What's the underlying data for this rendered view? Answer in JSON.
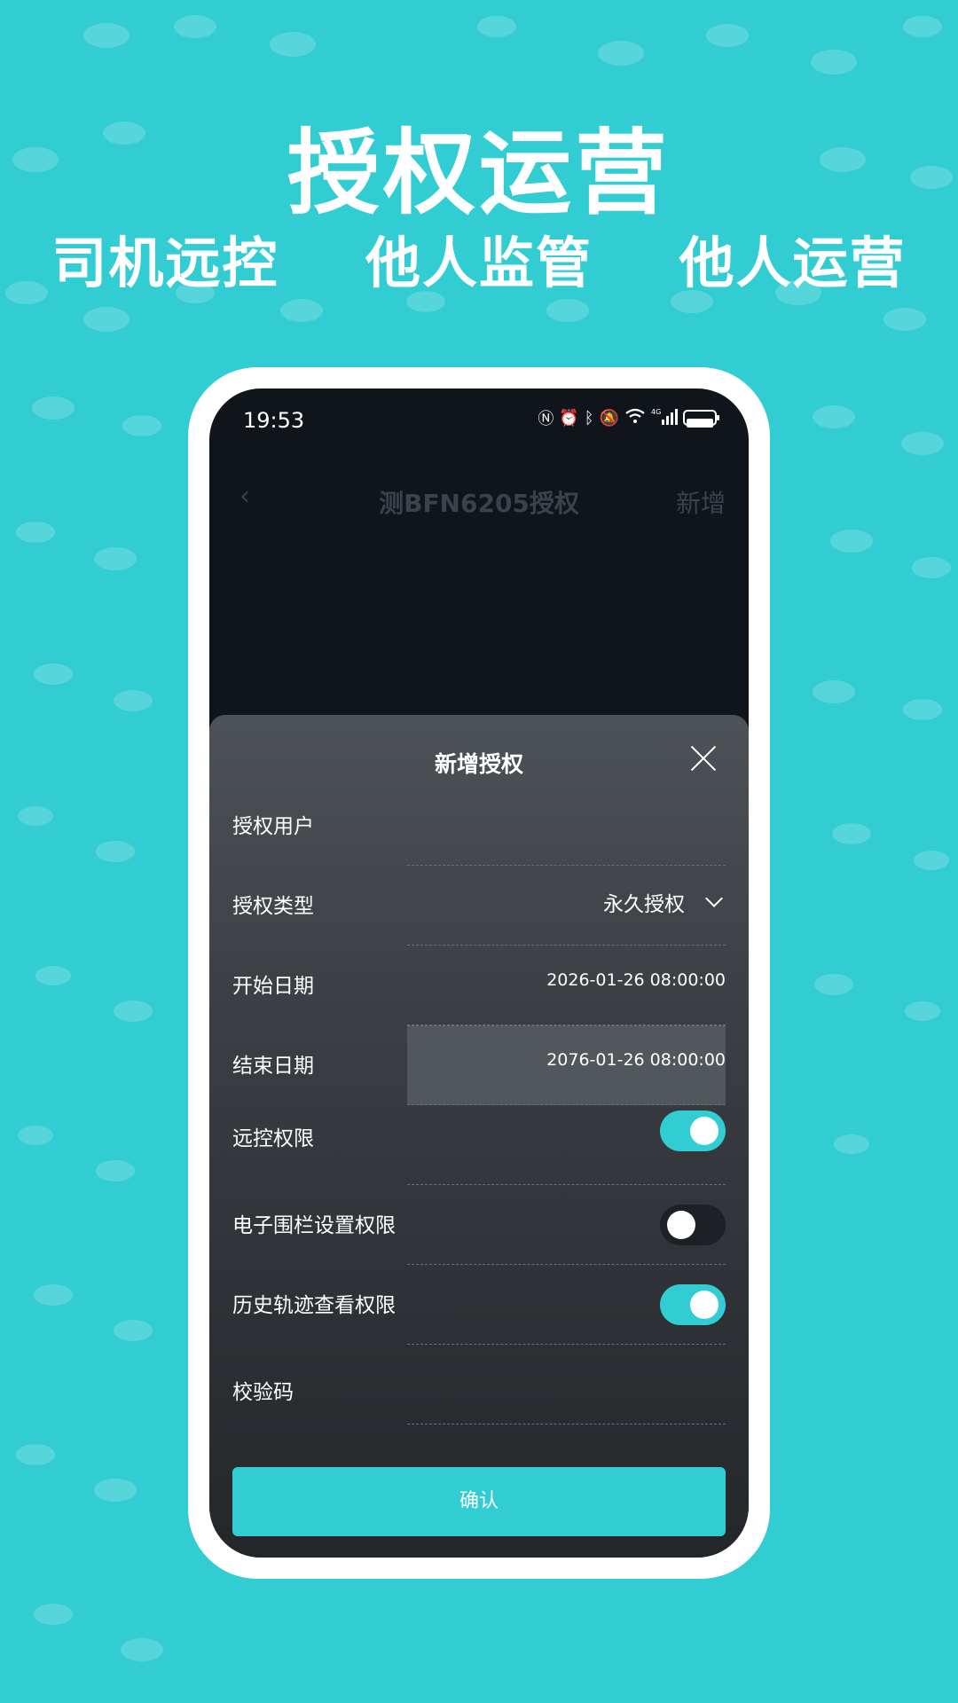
{
  "promo": {
    "headline": "授权运营",
    "sub_items": [
      "司机远控",
      "他人监管",
      "他人运营"
    ]
  },
  "status_bar": {
    "time": "19:53",
    "icons": [
      "nfc-icon",
      "alarm-icon",
      "bluetooth-icon",
      "mute-icon",
      "wifi-icon",
      "4g-signal-icon",
      "battery-icon"
    ],
    "network_label": "4G"
  },
  "nav": {
    "back_glyph": "‹",
    "title": "测BFN6205授权",
    "action_label": "新增"
  },
  "sheet": {
    "title": "新增授权",
    "fields": {
      "user": {
        "label": "授权用户",
        "value": ""
      },
      "type": {
        "label": "授权类型",
        "value": "永久授权"
      },
      "start": {
        "label": "开始日期",
        "value": "2026-01-26 08:00:00"
      },
      "end": {
        "label": "结束日期",
        "value": "2076-01-26 08:00:00"
      },
      "remote": {
        "label": "远控权限",
        "on": true
      },
      "fence": {
        "label": "电子围栏设置权限",
        "on": false
      },
      "history": {
        "label": "历史轨迹查看权限",
        "on": true
      },
      "code": {
        "label": "校验码",
        "value": ""
      }
    },
    "confirm_label": "确认"
  },
  "colors": {
    "accent": "#31cdd2",
    "screen_bg": "#10151c",
    "sheet_top": "#4d5256",
    "sheet_bottom": "#24272a"
  }
}
